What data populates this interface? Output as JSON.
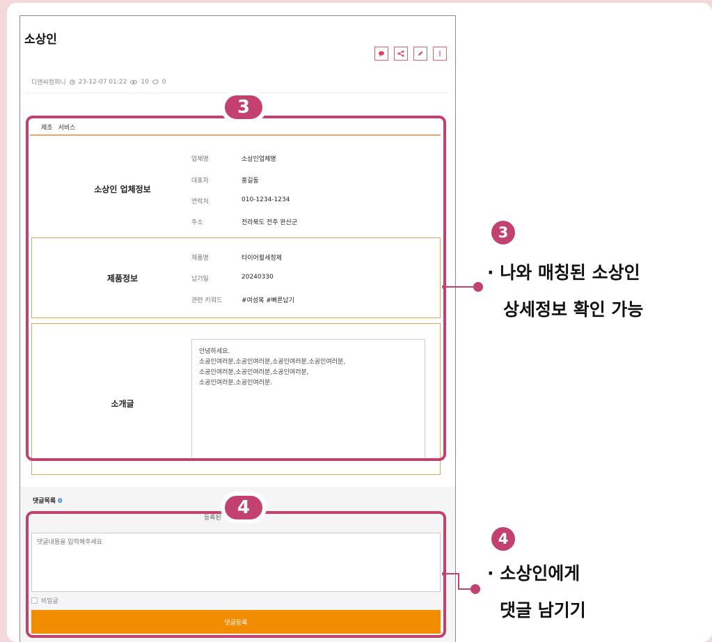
{
  "post": {
    "title": "소상인",
    "meta": {
      "author": "디앤씨컴퍼니",
      "datetime": "23-12-07 01:22",
      "views": "10",
      "comments": "0"
    },
    "categories": [
      "제조",
      "서비스"
    ]
  },
  "company_info": {
    "section_title": "소상인 업체정보",
    "fields": [
      {
        "label": "업체명",
        "value": "소상인업체명"
      },
      {
        "label": "대표자",
        "value": "홍길동"
      },
      {
        "label": "연락처",
        "value": "010-1234-1234"
      },
      {
        "label": "주소",
        "value": "전라북도 전주 완산군"
      }
    ]
  },
  "product_info": {
    "section_title": "제품정보",
    "fields": [
      {
        "label": "제품명",
        "value": "타이어휠세정제"
      },
      {
        "label": "납기일",
        "value": "20240330"
      },
      {
        "label": "관련 키워드",
        "value": "#여성복 #빠른납기"
      }
    ]
  },
  "intro": {
    "section_title": "소개글",
    "text": "안녕하세요.\n소공인여러분,소공인여러분,소공인여러분,소공인여러분,\n소공인여러분,소공인여러분,소공인여러분,\n소공인여러분,소공인여러분."
  },
  "comments": {
    "heading": "댓글목록",
    "count": "0",
    "partial_label": "등록된",
    "input_placeholder": "댓글내용을 입력해주세요",
    "secret_label": "비밀글",
    "submit_label": "댓글등록"
  },
  "annotations": {
    "badge3": "3",
    "badge4": "4",
    "note3_line1": "· 나와 매칭된 소상인",
    "note3_line2": "상세정보 확인 가능",
    "note4_line1": "· 소상인에게",
    "note4_line2": "댓글 남기기"
  },
  "colors": {
    "highlight": "#c2416f",
    "accent_orange": "#f28c00",
    "section_border": "#d9a85a",
    "background": "#f3d9d9"
  },
  "icons": [
    "comment-icon",
    "share-icon",
    "edit-icon",
    "more-icon",
    "clock-icon",
    "eye-icon"
  ]
}
